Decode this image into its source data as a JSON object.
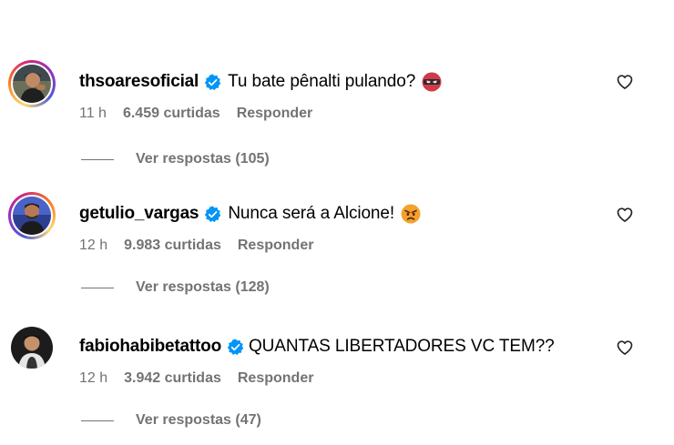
{
  "comments": [
    {
      "username": "thsoaresoficial",
      "text": "Tu bate pênalti pulando?",
      "emoji": "ninja-face-emoji",
      "time": "11 h",
      "likes": "6.459 curtidas",
      "reply_label": "Responder",
      "view_replies": "Ver respostas (105)"
    },
    {
      "username": "getulio_vargas",
      "text": "Nunca será a Alcione!",
      "emoji": "angry-face-emoji",
      "time": "12 h",
      "likes": "9.983 curtidas",
      "reply_label": "Responder",
      "view_replies": "Ver respostas (128)"
    },
    {
      "username": "fabiohabibetattoo",
      "text": "QUANTAS LIBERTADORES VC TEM??",
      "emoji": "",
      "time": "12 h",
      "likes": "3.942 curtidas",
      "reply_label": "Responder",
      "view_replies": "Ver respostas (47)"
    }
  ],
  "colors": {
    "verified_blue": "#0095f6",
    "secondary_text": "#737373",
    "primary_text": "#000000"
  },
  "icons": {
    "verified": "verified-badge-icon",
    "like": "heart-outline-icon"
  }
}
